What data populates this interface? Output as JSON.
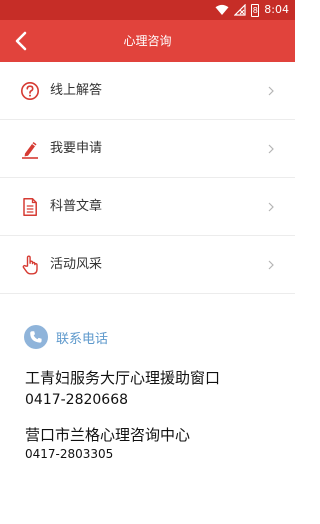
{
  "status_bar": {
    "time": "8:04",
    "battery_level": "8"
  },
  "header": {
    "title": "心理咨询"
  },
  "menu": {
    "items": [
      {
        "label": "线上解答",
        "icon": "question-circle-icon"
      },
      {
        "label": "我要申请",
        "icon": "pen-icon"
      },
      {
        "label": "科普文章",
        "icon": "document-icon"
      },
      {
        "label": "活动风采",
        "icon": "hand-pointer-icon"
      }
    ]
  },
  "contact": {
    "title": "联系电话",
    "entries": [
      {
        "name": "工青妇服务大厅心理援助窗口",
        "phone": "0417-2820668"
      },
      {
        "name": "营口市兰格心理咨询中心",
        "phone": "0417-2803305"
      }
    ]
  },
  "colors": {
    "status_bar": "#c62d27",
    "app_bar": "#e1433c",
    "icon_red": "#d63b33",
    "contact_blue": "#5e99cc"
  }
}
